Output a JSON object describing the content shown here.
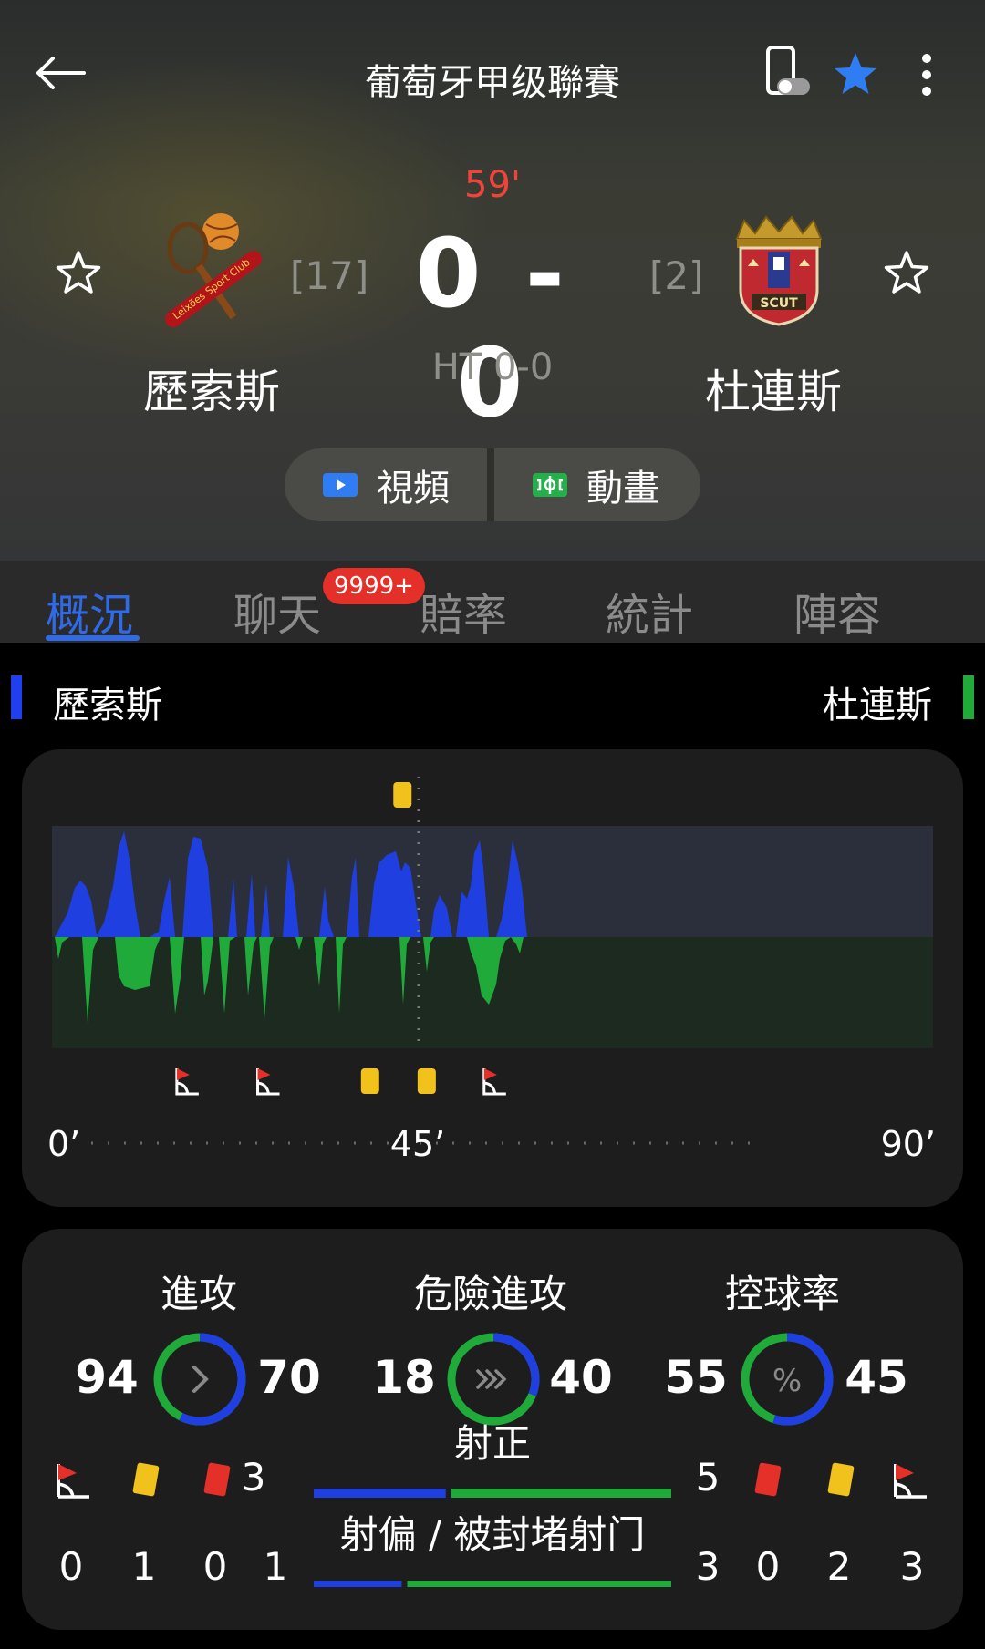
{
  "header": {
    "title": "葡萄牙甲级聯賽",
    "minute": "59'",
    "score": "0 - 0",
    "half_time": "HT 0-0",
    "home": {
      "name": "歷索斯",
      "rank": "[17]"
    },
    "away": {
      "name": "杜連斯",
      "rank": "[2]"
    },
    "video_label": "視頻",
    "animation_label": "動畫"
  },
  "tabs": [
    {
      "label": "概況"
    },
    {
      "label": "聊天"
    },
    {
      "label": "賠率"
    },
    {
      "label": "統計"
    },
    {
      "label": "陣容"
    }
  ],
  "chat_badge": "9999+",
  "teambar": {
    "home": "歷索斯",
    "away": "杜連斯"
  },
  "timeline": {
    "labels": {
      "start": "0’",
      "mid": "45’",
      "end": "90’"
    },
    "home_color": "#1f3fe0",
    "away_color": "#1faa3a",
    "top_events": [
      {
        "type": "yellow-card",
        "minute": 43
      }
    ],
    "bottom_events": [
      {
        "type": "corner",
        "minute": 16
      },
      {
        "type": "corner",
        "minute": 26
      },
      {
        "type": "yellow-card",
        "minute": 39
      },
      {
        "type": "yellow-card",
        "minute": 46
      },
      {
        "type": "corner",
        "minute": 54
      }
    ]
  },
  "stats": {
    "attack": {
      "label": "進攻",
      "home": "94",
      "away": "70",
      "home_value": 94,
      "away_value": 70,
      "icon": "chevron-right-icon"
    },
    "dangerous": {
      "label": "危險進攻",
      "home": "18",
      "away": "40",
      "home_value": 18,
      "away_value": 40,
      "icon": "triple-chevron-icon"
    },
    "possession": {
      "label": "控球率",
      "home": "55",
      "away": "45",
      "home_value": 55,
      "away_value": 45,
      "icon": "percent-icon",
      "icon_text": "%"
    },
    "shots_on": {
      "label": "射正",
      "home": "3",
      "away": "5",
      "home_value": 3,
      "away_value": 5
    },
    "shots_off": {
      "label": "射偏 / 被封堵射门",
      "home": "1",
      "away": "3",
      "home_value": 1,
      "away_value": 3
    },
    "home_cards": {
      "corners": "0",
      "yellow": "1",
      "red": "0"
    },
    "away_cards": {
      "red": "0",
      "yellow": "2",
      "corners": "3"
    }
  }
}
